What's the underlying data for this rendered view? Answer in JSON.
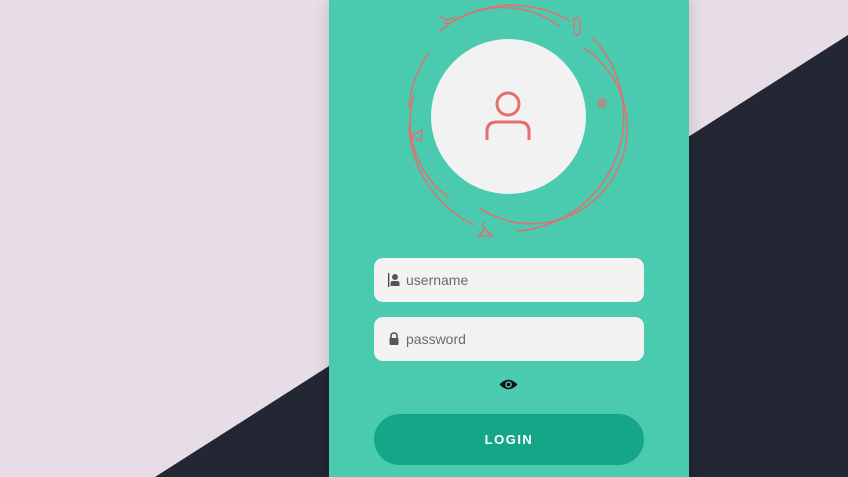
{
  "form": {
    "username_placeholder": "username",
    "password_placeholder": "password",
    "login_label": "LOGIN"
  },
  "icons": {
    "avatar": "user-icon",
    "username": "user-icon",
    "password": "lock-icon",
    "toggle": "eye-icon",
    "orbit": [
      "envelope-icon",
      "paperclip-icon",
      "at-sign-icon",
      "send-icon",
      "hanger-icon"
    ]
  },
  "colors": {
    "background_light": "#e7dde6",
    "background_dark": "#232633",
    "card": "#4acbb0",
    "button": "#15a587",
    "accent": "#e46e6e",
    "field": "#f2f2f2"
  }
}
